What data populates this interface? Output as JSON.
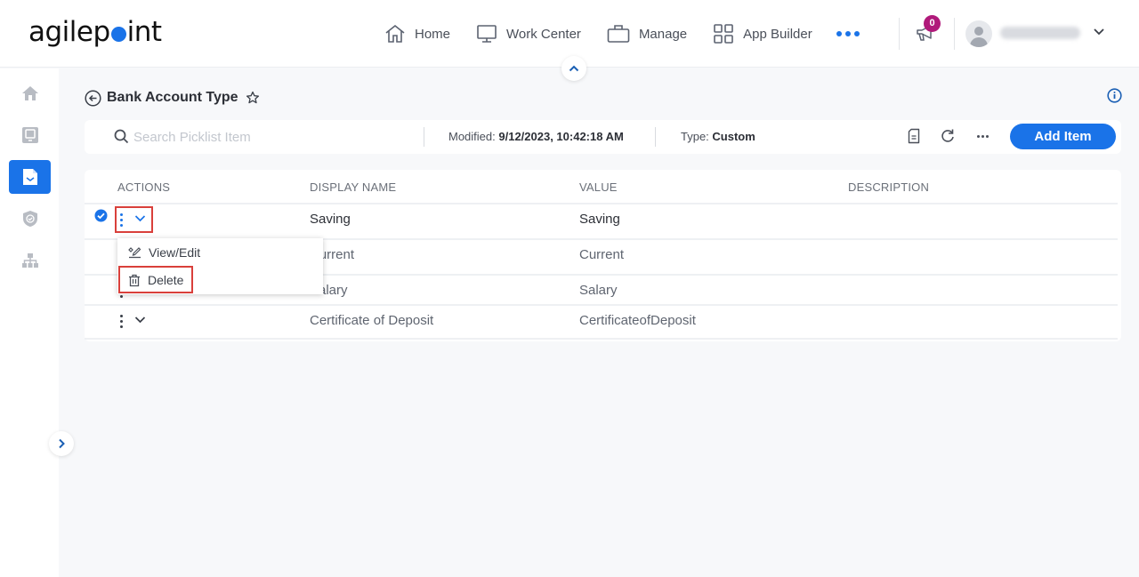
{
  "app": {
    "logo_text_before": "agilep",
    "logo_text_after": "int",
    "brand_color": "#1a73e8"
  },
  "topnav": {
    "items": [
      {
        "label": "Home",
        "icon": "home-icon"
      },
      {
        "label": "Work Center",
        "icon": "monitor-icon"
      },
      {
        "label": "Manage",
        "icon": "briefcase-icon"
      },
      {
        "label": "App Builder",
        "icon": "grid-icon"
      }
    ],
    "more_icon": "more-horizontal-icon",
    "notification_count": "0",
    "user_name": "blurred user",
    "user_menu_icon": "chevron-down-icon"
  },
  "sidebar": {
    "items": [
      {
        "name": "home",
        "icon": "home-icon",
        "active": false
      },
      {
        "name": "work-center",
        "icon": "monitor-icon",
        "active": false
      },
      {
        "name": "data-entities",
        "icon": "document-check-icon",
        "active": true
      },
      {
        "name": "security",
        "icon": "shield-icon",
        "active": false
      },
      {
        "name": "organization",
        "icon": "hierarchy-icon",
        "active": false
      }
    ]
  },
  "page": {
    "title": "Bank Account Type",
    "search_placeholder": "Search Picklist Item",
    "search_value": "",
    "modified_label": "Modified:",
    "modified_value": "9/12/2023, 10:42:18 AM",
    "type_label": "Type:",
    "type_value": "Custom",
    "add_button": "Add Item"
  },
  "table": {
    "columns": [
      "ACTIONS",
      "DISPLAY NAME",
      "VALUE",
      "DESCRIPTION"
    ],
    "rows": [
      {
        "display_name": "Saving",
        "value": "Saving",
        "description": "",
        "selected": true
      },
      {
        "display_name": "Current",
        "value": "Current",
        "description": "",
        "selected": false
      },
      {
        "display_name": "Salary",
        "value": "Salary",
        "description": "",
        "selected": false
      },
      {
        "display_name": "Certificate of Deposit",
        "value": "CertificateofDeposit",
        "description": "",
        "selected": false
      }
    ]
  },
  "menu": {
    "items": [
      {
        "label": "View/Edit",
        "icon": "edit-icon"
      },
      {
        "label": "Delete",
        "icon": "trash-icon"
      }
    ]
  }
}
